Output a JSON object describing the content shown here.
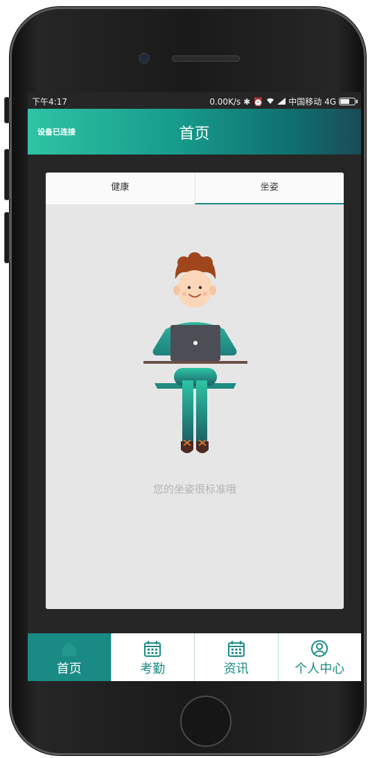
{
  "status_bar": {
    "time": "下午4:17",
    "network_speed": "0.00K/s",
    "carrier": "中国移动 4G",
    "icons": [
      "bluetooth-icon",
      "alarm-icon",
      "wifi-icon",
      "signal-icon",
      "battery-icon"
    ]
  },
  "header": {
    "connection_status": "设备已连接",
    "title": "首页"
  },
  "tabs": [
    {
      "label": "健康",
      "active": false
    },
    {
      "label": "坐姿",
      "active": true
    }
  ],
  "posture": {
    "message": "您的坐姿很标准哦"
  },
  "bottom_nav": {
    "items": [
      {
        "label": "首页",
        "icon": "home-icon",
        "active": true
      },
      {
        "label": "考勤",
        "icon": "calendar-icon",
        "active": false
      },
      {
        "label": "资讯",
        "icon": "calendar-icon",
        "active": false
      },
      {
        "label": "个人中心",
        "icon": "user-icon",
        "active": false
      }
    ]
  },
  "colors": {
    "accent": "#1a8a84",
    "header_gradient_start": "#2ec4a4",
    "header_gradient_end": "#1c4a58",
    "card_background": "#e6e6e6",
    "message_text": "#b3b3b3"
  }
}
